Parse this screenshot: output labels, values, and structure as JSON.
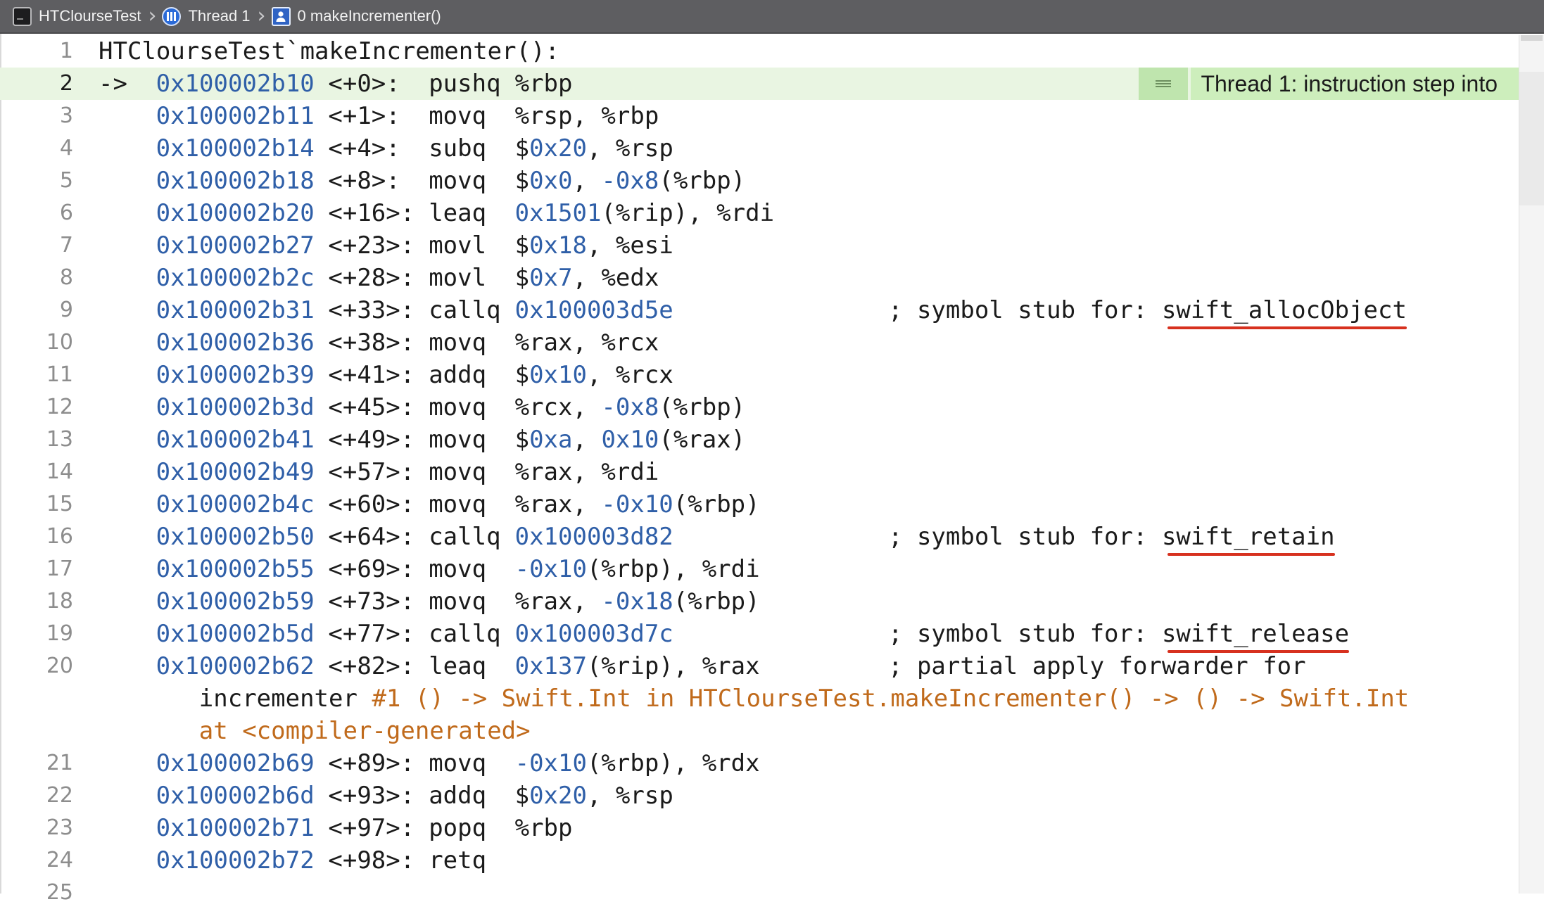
{
  "jumpbar": {
    "project": "HTClourseTest",
    "thread": "Thread 1",
    "frame": "0 makeIncrementer()"
  },
  "annotation": {
    "text": "Thread 1: instruction step into",
    "line": 2
  },
  "lines": [
    {
      "n": "1",
      "header": "HTClourseTest`makeIncrementer():"
    },
    {
      "n": "2",
      "arrow": "->",
      "addr": "0x100002b10",
      "off": "<+0>:",
      "op": "pushq",
      "args": "%rbp",
      "current": true
    },
    {
      "n": "3",
      "addr": "0x100002b11",
      "off": "<+1>:",
      "op": "movq",
      "args": "%rsp, %rbp"
    },
    {
      "n": "4",
      "addr": "0x100002b14",
      "off": "<+4>:",
      "op": "subq",
      "args": "$0x20, %rsp"
    },
    {
      "n": "5",
      "addr": "0x100002b18",
      "off": "<+8>:",
      "op": "movq",
      "args": "$0x0, -0x8(%rbp)"
    },
    {
      "n": "6",
      "addr": "0x100002b20",
      "off": "<+16>:",
      "op": "leaq",
      "args": "0x1501(%rip), %rdi"
    },
    {
      "n": "7",
      "addr": "0x100002b27",
      "off": "<+23>:",
      "op": "movl",
      "args": "$0x18, %esi"
    },
    {
      "n": "8",
      "addr": "0x100002b2c",
      "off": "<+28>:",
      "op": "movl",
      "args": "$0x7, %edx"
    },
    {
      "n": "9",
      "addr": "0x100002b31",
      "off": "<+33>:",
      "op": "callq",
      "args": "0x100003d5e",
      "comment": "; symbol stub for:",
      "symbol": "swift_allocObject"
    },
    {
      "n": "10",
      "addr": "0x100002b36",
      "off": "<+38>:",
      "op": "movq",
      "args": "%rax, %rcx"
    },
    {
      "n": "11",
      "addr": "0x100002b39",
      "off": "<+41>:",
      "op": "addq",
      "args": "$0x10, %rcx"
    },
    {
      "n": "12",
      "addr": "0x100002b3d",
      "off": "<+45>:",
      "op": "movq",
      "args": "%rcx, -0x8(%rbp)"
    },
    {
      "n": "13",
      "addr": "0x100002b41",
      "off": "<+49>:",
      "op": "movq",
      "args": "$0xa, 0x10(%rax)"
    },
    {
      "n": "14",
      "addr": "0x100002b49",
      "off": "<+57>:",
      "op": "movq",
      "args": "%rax, %rdi"
    },
    {
      "n": "15",
      "addr": "0x100002b4c",
      "off": "<+60>:",
      "op": "movq",
      "args": "%rax, -0x10(%rbp)"
    },
    {
      "n": "16",
      "addr": "0x100002b50",
      "off": "<+64>:",
      "op": "callq",
      "args": "0x100003d82",
      "comment": "; symbol stub for:",
      "symbol": "swift_retain"
    },
    {
      "n": "17",
      "addr": "0x100002b55",
      "off": "<+69>:",
      "op": "movq",
      "args": "-0x10(%rbp), %rdi"
    },
    {
      "n": "18",
      "addr": "0x100002b59",
      "off": "<+73>:",
      "op": "movq",
      "args": "%rax, -0x18(%rbp)"
    },
    {
      "n": "19",
      "addr": "0x100002b5d",
      "off": "<+77>:",
      "op": "callq",
      "args": "0x100003d7c",
      "comment": "; symbol stub for:",
      "symbol": "swift_release"
    },
    {
      "n": "20",
      "addr": "0x100002b62",
      "off": "<+82>:",
      "op": "leaq",
      "args": "0x137(%rip), %rax",
      "comment": "; partial apply forwarder for",
      "cont1_a": "incrementer",
      "cont1_b": " #1 () -> Swift.Int in HTClourseTest.makeIncrementer() -> () -> Swift.Int",
      "cont2": "at <compiler-generated>"
    },
    {
      "n": "21",
      "addr": "0x100002b69",
      "off": "<+89>:",
      "op": "movq",
      "args": "-0x10(%rbp), %rdx"
    },
    {
      "n": "22",
      "addr": "0x100002b6d",
      "off": "<+93>:",
      "op": "addq",
      "args": "$0x20, %rsp"
    },
    {
      "n": "23",
      "addr": "0x100002b71",
      "off": "<+97>:",
      "op": "popq",
      "args": "%rbp"
    },
    {
      "n": "24",
      "addr": "0x100002b72",
      "off": "<+98>:",
      "op": "retq",
      "args": ""
    },
    {
      "n": "25"
    }
  ]
}
